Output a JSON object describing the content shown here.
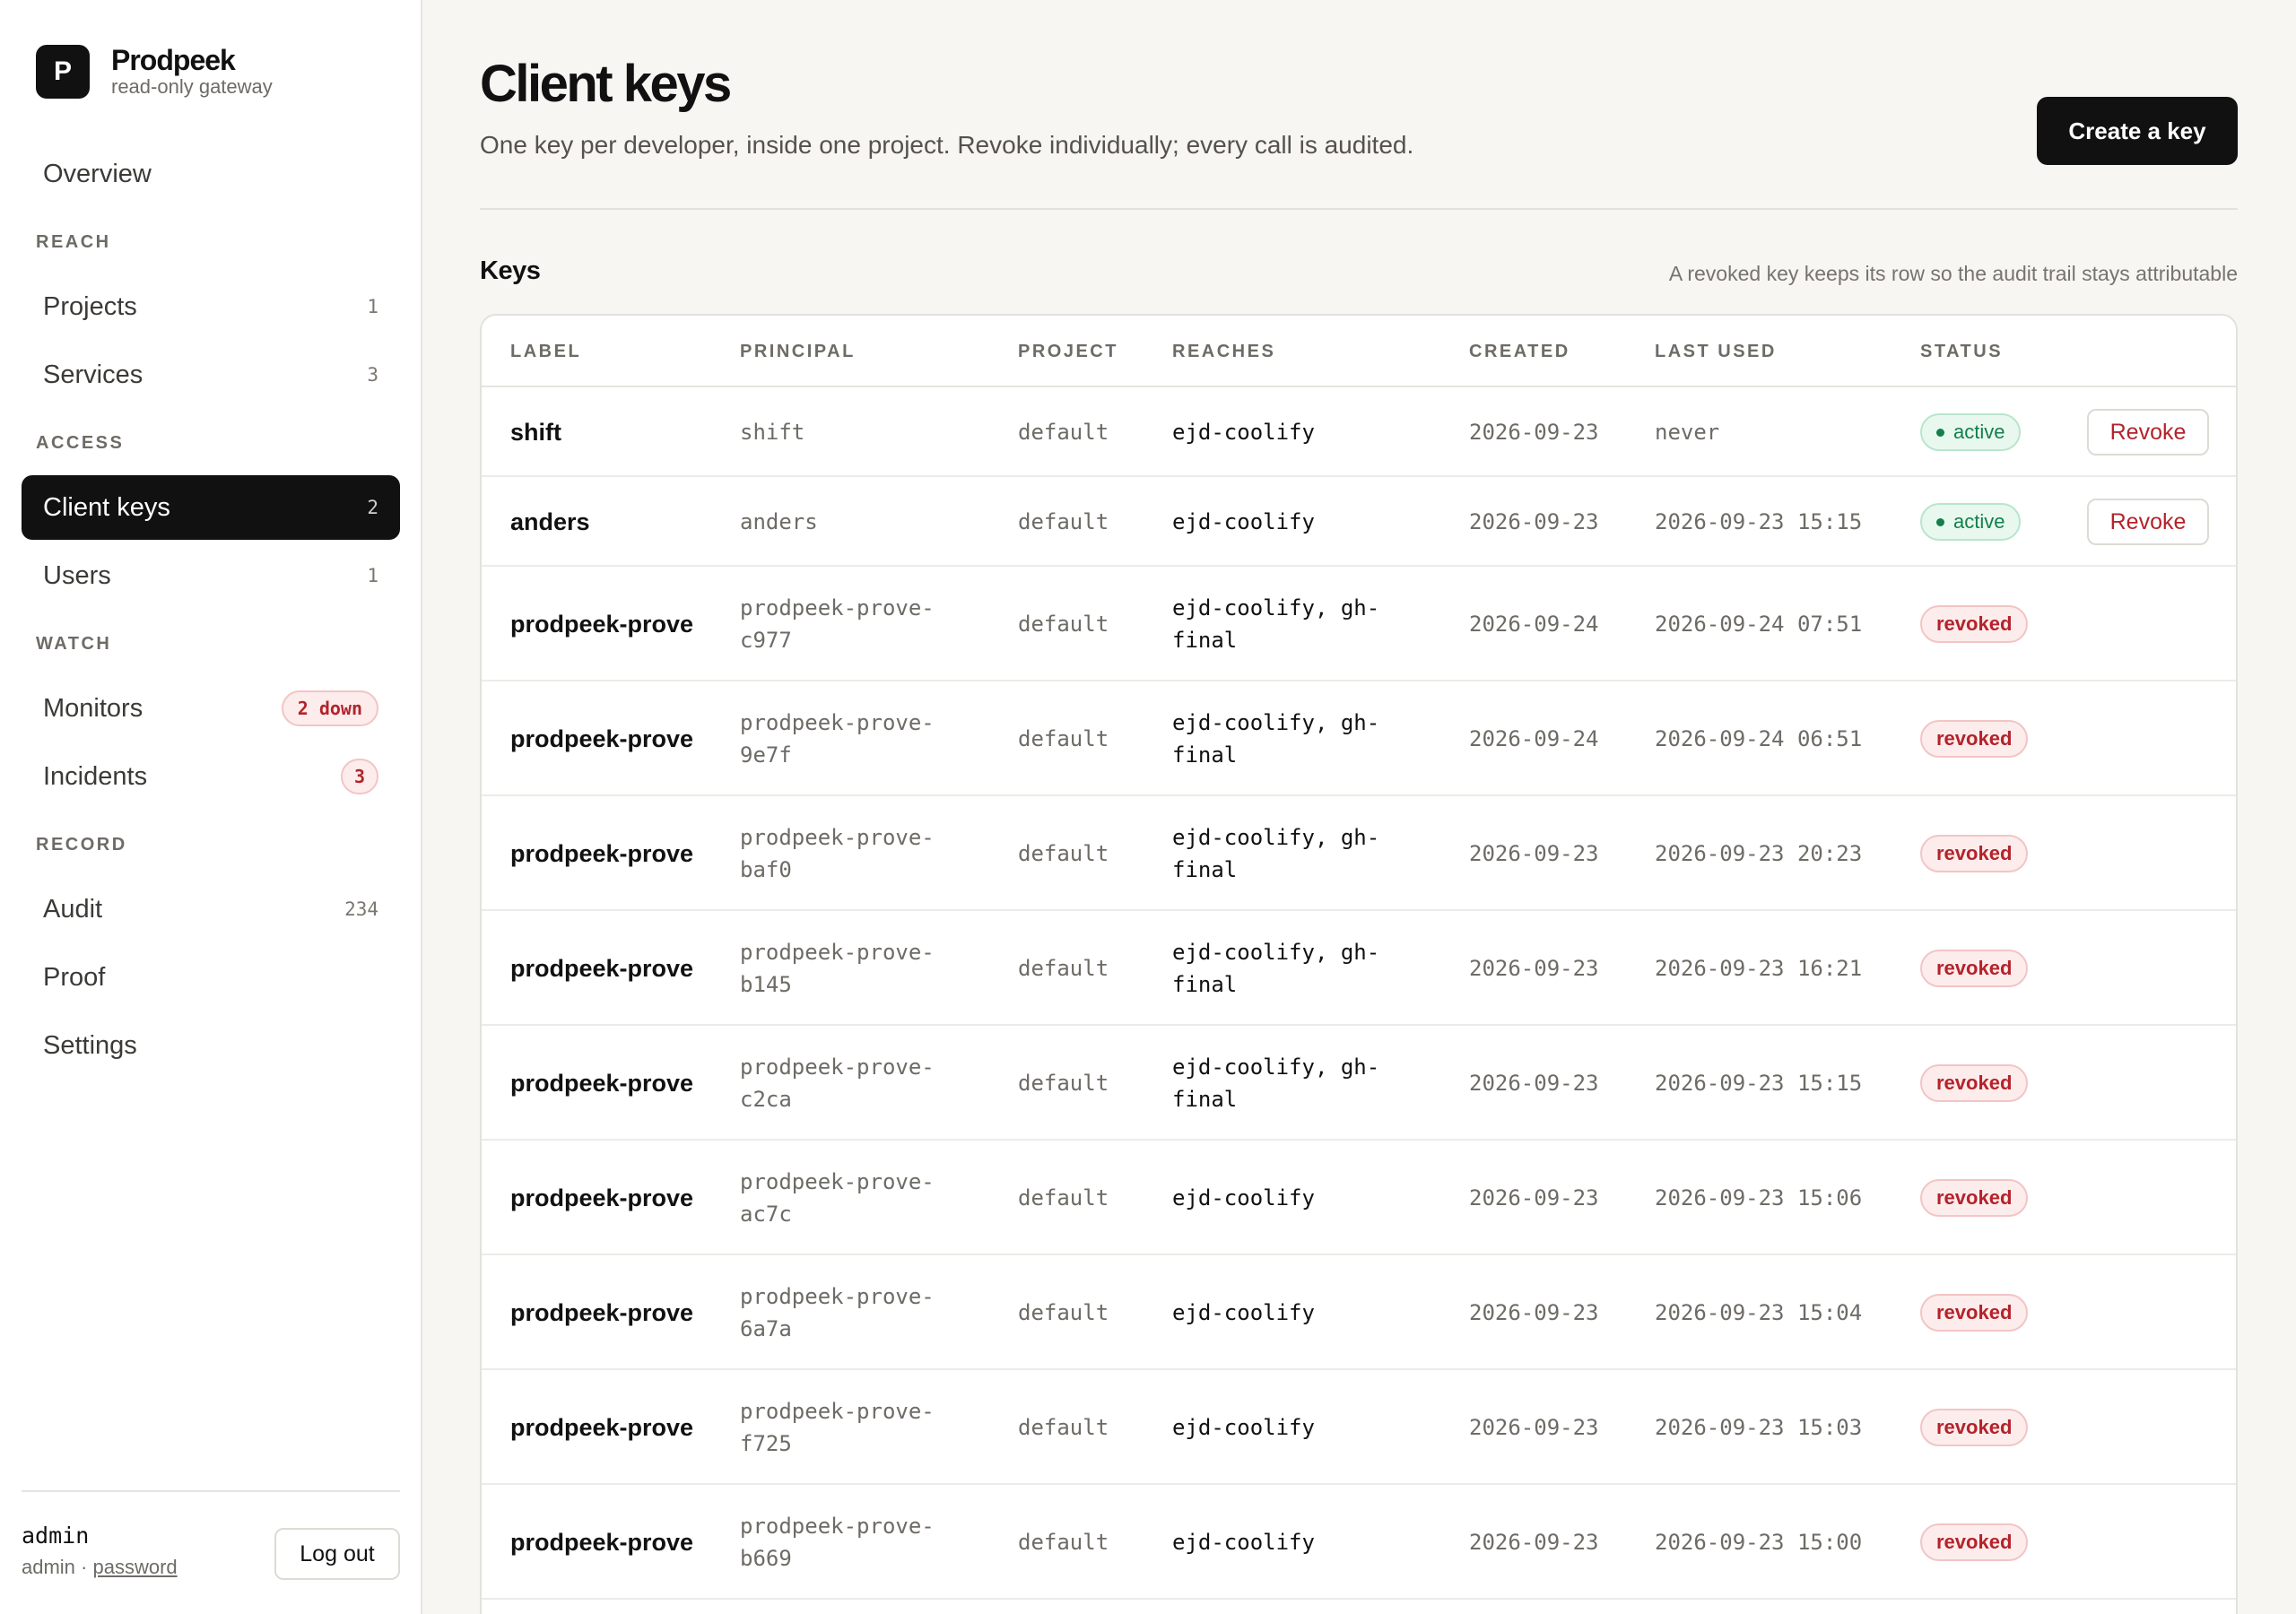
{
  "brand": {
    "logo_letter": "P",
    "name": "Prodpeek",
    "subtitle": "read-only gateway"
  },
  "nav": {
    "overview": "Overview",
    "sections": {
      "reach": "REACH",
      "access": "ACCESS",
      "watch": "WATCH",
      "record": "RECORD"
    },
    "projects": {
      "label": "Projects",
      "count": "1"
    },
    "services": {
      "label": "Services",
      "count": "3"
    },
    "client_keys": {
      "label": "Client keys",
      "count": "2"
    },
    "users": {
      "label": "Users",
      "count": "1"
    },
    "monitors": {
      "label": "Monitors",
      "badge": "2 down"
    },
    "incidents": {
      "label": "Incidents",
      "badge": "3"
    },
    "audit": {
      "label": "Audit",
      "count": "234"
    },
    "proof": {
      "label": "Proof"
    },
    "settings": {
      "label": "Settings"
    }
  },
  "footer": {
    "username": "admin",
    "role": "admin",
    "separator": "·",
    "password_link": "password",
    "logout": "Log out"
  },
  "header": {
    "title": "Client keys",
    "subtitle": "One key per developer, inside one project. Revoke individually; every call is audited.",
    "create_button": "Create a key"
  },
  "keys_section": {
    "title": "Keys",
    "note": "A revoked key keeps its row so the audit trail stays attributable"
  },
  "table": {
    "columns": [
      "LABEL",
      "PRINCIPAL",
      "PROJECT",
      "REACHES",
      "CREATED",
      "LAST USED",
      "STATUS"
    ],
    "revoke_label": "Revoke",
    "rows": [
      {
        "label": "shift",
        "principal": "shift",
        "project": "default",
        "reaches": "ejd-coolify",
        "created": "2026-09-23",
        "last_used": "never",
        "status": "active"
      },
      {
        "label": "anders",
        "principal": "anders",
        "project": "default",
        "reaches": "ejd-coolify",
        "created": "2026-09-23",
        "last_used": "2026-09-23 15:15",
        "status": "active"
      },
      {
        "label": "prodpeek-prove",
        "principal": "prodpeek-prove-c977",
        "project": "default",
        "reaches": "ejd-coolify, gh-final",
        "created": "2026-09-24",
        "last_used": "2026-09-24 07:51",
        "status": "revoked"
      },
      {
        "label": "prodpeek-prove",
        "principal": "prodpeek-prove-9e7f",
        "project": "default",
        "reaches": "ejd-coolify, gh-final",
        "created": "2026-09-24",
        "last_used": "2026-09-24 06:51",
        "status": "revoked"
      },
      {
        "label": "prodpeek-prove",
        "principal": "prodpeek-prove-baf0",
        "project": "default",
        "reaches": "ejd-coolify, gh-final",
        "created": "2026-09-23",
        "last_used": "2026-09-23 20:23",
        "status": "revoked"
      },
      {
        "label": "prodpeek-prove",
        "principal": "prodpeek-prove-b145",
        "project": "default",
        "reaches": "ejd-coolify, gh-final",
        "created": "2026-09-23",
        "last_used": "2026-09-23 16:21",
        "status": "revoked"
      },
      {
        "label": "prodpeek-prove",
        "principal": "prodpeek-prove-c2ca",
        "project": "default",
        "reaches": "ejd-coolify, gh-final",
        "created": "2026-09-23",
        "last_used": "2026-09-23 15:15",
        "status": "revoked"
      },
      {
        "label": "prodpeek-prove",
        "principal": "prodpeek-prove-ac7c",
        "project": "default",
        "reaches": "ejd-coolify",
        "created": "2026-09-23",
        "last_used": "2026-09-23 15:06",
        "status": "revoked"
      },
      {
        "label": "prodpeek-prove",
        "principal": "prodpeek-prove-6a7a",
        "project": "default",
        "reaches": "ejd-coolify",
        "created": "2026-09-23",
        "last_used": "2026-09-23 15:04",
        "status": "revoked"
      },
      {
        "label": "prodpeek-prove",
        "principal": "prodpeek-prove-f725",
        "project": "default",
        "reaches": "ejd-coolify",
        "created": "2026-09-23",
        "last_used": "2026-09-23 15:03",
        "status": "revoked"
      },
      {
        "label": "prodpeek-prove",
        "principal": "prodpeek-prove-b669",
        "project": "default",
        "reaches": "ejd-coolify",
        "created": "2026-09-23",
        "last_used": "2026-09-23 15:00",
        "status": "revoked"
      }
    ]
  }
}
